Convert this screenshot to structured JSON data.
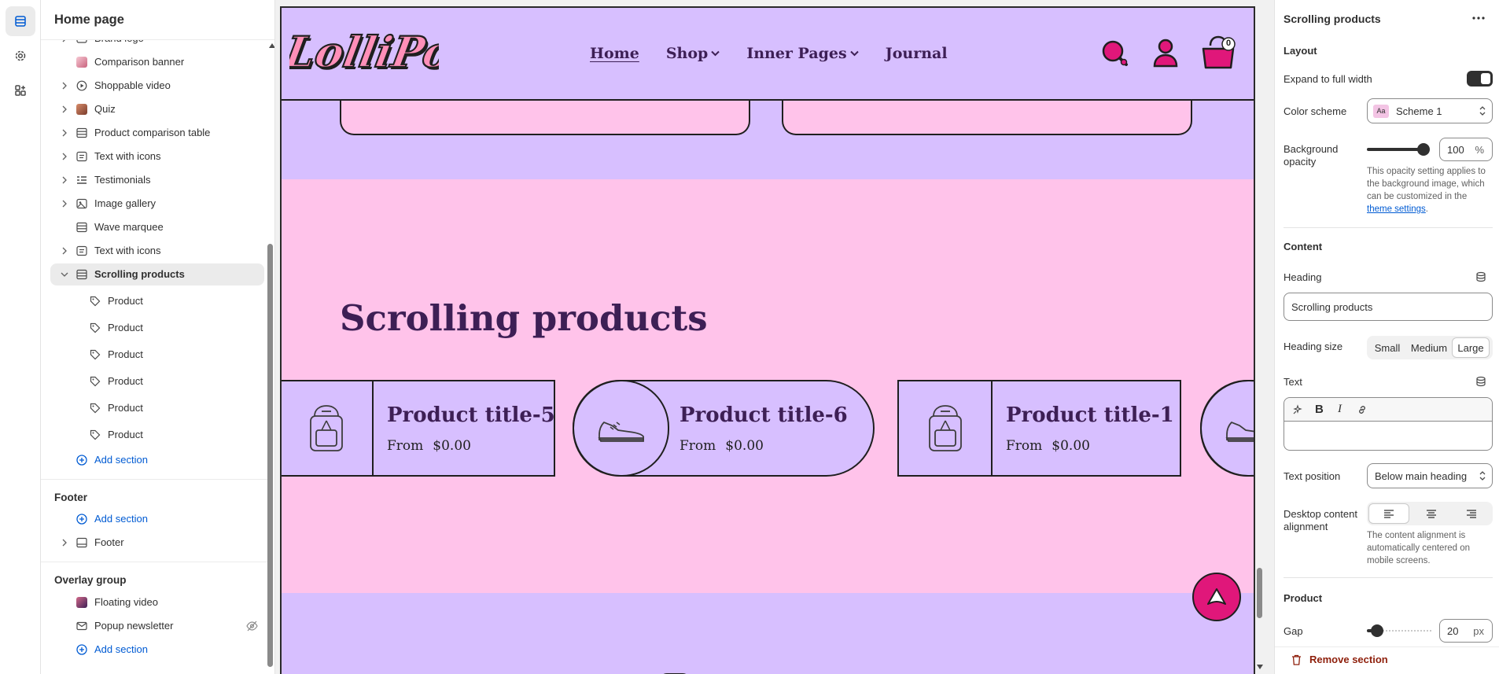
{
  "left": {
    "title": "Home page",
    "items": [
      {
        "label": "Brand logo",
        "icon": "image-icon"
      },
      {
        "label": "Comparison banner",
        "icon": "image-thumb"
      },
      {
        "label": "Shoppable video",
        "icon": "play-icon"
      },
      {
        "label": "Quiz",
        "icon": "image-thumb"
      },
      {
        "label": "Product comparison table",
        "icon": "section-icon"
      },
      {
        "label": "Text with icons",
        "icon": "text-icon"
      },
      {
        "label": "Testimonials",
        "icon": "list-icon"
      },
      {
        "label": "Image gallery",
        "icon": "gallery-icon"
      },
      {
        "label": "Wave marquee",
        "icon": "section-icon"
      },
      {
        "label": "Text with icons",
        "icon": "text-icon"
      },
      {
        "label": "Scrolling products",
        "icon": "section-icon"
      }
    ],
    "children": [
      "Product",
      "Product",
      "Product",
      "Product",
      "Product",
      "Product"
    ],
    "add_section": "Add section",
    "footer_group": "Footer",
    "footer_item": "Footer",
    "overlay_group": "Overlay group",
    "overlay_items": [
      "Floating video",
      "Popup newsletter"
    ]
  },
  "preview": {
    "logo": "LolliPop",
    "nav": [
      "Home",
      "Shop",
      "Inner Pages",
      "Journal"
    ],
    "cart_count": "0",
    "heading": "Scrolling products",
    "products": [
      {
        "title": "Product title-5",
        "from": "From",
        "price": "$0.00",
        "icon": "backpack-icon"
      },
      {
        "title": "Product title-6",
        "from": "From",
        "price": "$0.00",
        "icon": "sneaker-icon"
      },
      {
        "title": "Product title-1",
        "from": "From",
        "price": "$0.00",
        "icon": "backpack-icon"
      }
    ]
  },
  "right": {
    "title": "Scrolling products",
    "layout_label": "Layout",
    "expand_label": "Expand to full width",
    "color_scheme_label": "Color scheme",
    "color_scheme_value": "Scheme 1",
    "bg_opacity_label_1": "Background",
    "bg_opacity_label_2": "opacity",
    "bg_opacity_value": "100",
    "bg_opacity_unit": "%",
    "bg_opacity_level": 1.0,
    "opacity_help_1": "This opacity setting applies to",
    "opacity_help_2": "the background image, which",
    "opacity_help_3": "can be customized in the",
    "opacity_help_link": "theme settings",
    "content_label": "Content",
    "heading_label": "Heading",
    "heading_value": "Scrolling products",
    "heading_size_label": "Heading size",
    "heading_sizes": [
      "Small",
      "Medium",
      "Large"
    ],
    "heading_size_selected": "Large",
    "text_label": "Text",
    "text_position_label": "Text position",
    "text_position_value": "Below main heading",
    "desktop_align_label_1": "Desktop content",
    "desktop_align_label_2": "alignment",
    "align_help_1": "The content alignment is",
    "align_help_2": "automatically centered on",
    "align_help_3": "mobile screens.",
    "product_label": "Product",
    "gap_label": "Gap",
    "gap_value": "20",
    "gap_unit": "px",
    "remove_section": "Remove section"
  }
}
